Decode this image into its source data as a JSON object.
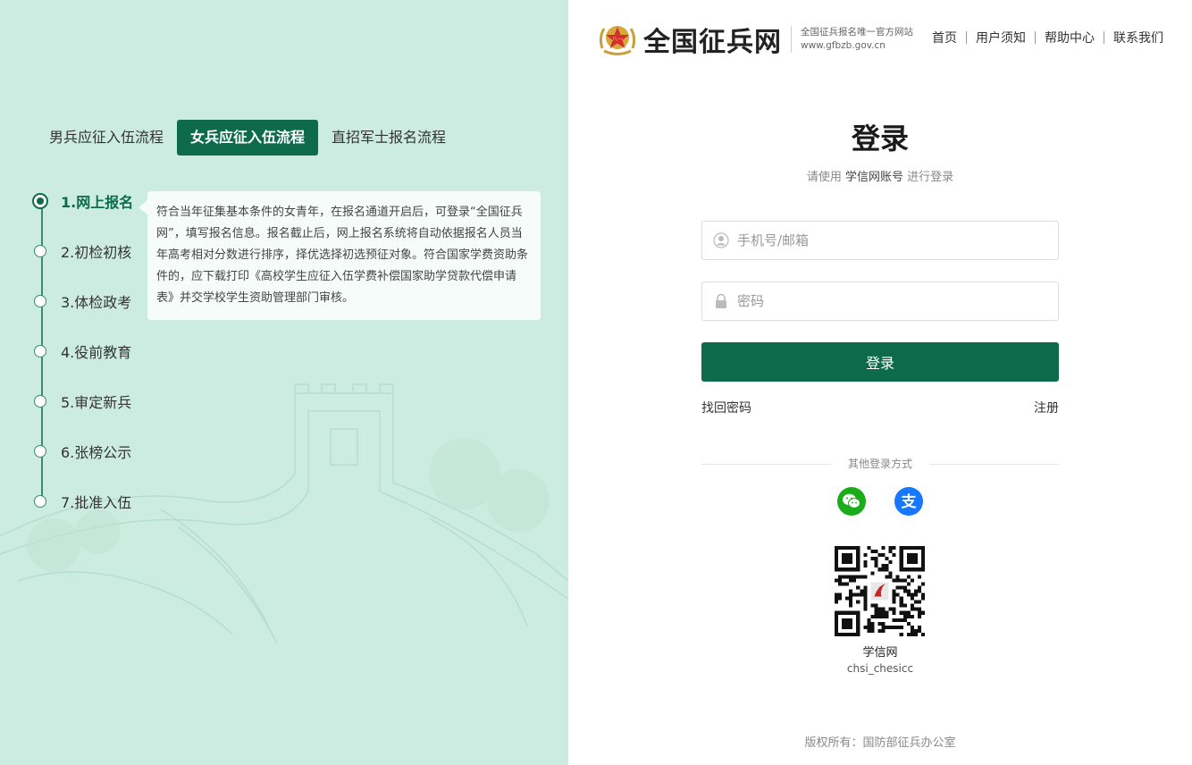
{
  "header": {
    "site_name": "全国征兵网",
    "sub_line1": "全国征兵报名唯一官方网站",
    "sub_line2": "www.gfbzb.gov.cn",
    "nav": [
      "首页",
      "用户须知",
      "帮助中心",
      "联系我们"
    ]
  },
  "process": {
    "tabs": [
      "男兵应征入伍流程",
      "女兵应征入伍流程",
      "直招军士报名流程"
    ],
    "active_tab": 1,
    "steps": [
      "1.网上报名",
      "2.初检初核",
      "3.体检政考",
      "4.役前教育",
      "5.审定新兵",
      "6.张榜公示",
      "7.批准入伍"
    ],
    "active_step": 0,
    "description": "符合当年征集基本条件的女青年，在报名通道开启后，可登录“全国征兵网”，填写报名信息。报名截止后，网上报名系统将自动依据报名人员当年高考相对分数进行排序，择优选择初选预征对象。符合国家学费资助条件的，应下载打印《高校学生应征入伍学费补偿国家助学贷款代偿申请表》并交学校学生资助管理部门审核。"
  },
  "login": {
    "title": "登录",
    "sub_prefix": "请使用",
    "sub_account": "学信网账号",
    "sub_suffix": "进行登录",
    "account_placeholder": "手机号/邮箱",
    "password_placeholder": "密码",
    "submit_label": "登录",
    "forgot_label": "找回密码",
    "register_label": "注册",
    "other_methods": "其他登录方式",
    "wechat_icon": "wechat-icon",
    "alipay_icon": "alipay-icon",
    "qr_title": "学信网",
    "qr_sub": "chsi_chesicc"
  },
  "footer": {
    "copyright": "版权所有：国防部征兵办公室"
  },
  "colors": {
    "primary": "#0d6b4c",
    "left_bg": "#cdece1",
    "wechat": "#1aad19",
    "alipay": "#1677ff"
  }
}
